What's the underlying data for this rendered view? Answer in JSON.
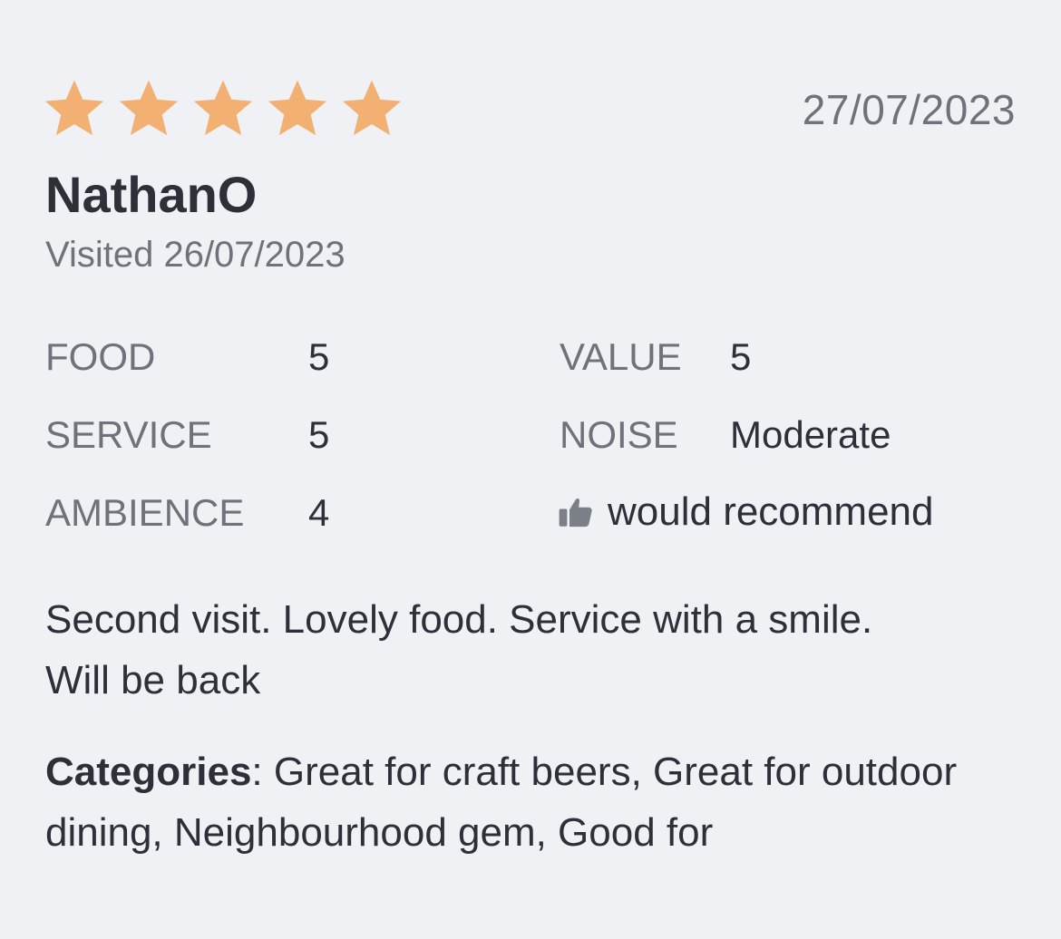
{
  "review": {
    "rating": 5,
    "rating_max": 5,
    "star_color": "#f2b073",
    "date": "27/07/2023",
    "reviewer": "NathanO",
    "visited": "Visited 26/07/2023",
    "ratings": {
      "food_label": "FOOD",
      "food_value": "5",
      "service_label": "SERVICE",
      "service_value": "5",
      "ambience_label": "AMBIENCE",
      "ambience_value": "4",
      "value_label": "VALUE",
      "value_value": "5",
      "noise_label": "NOISE",
      "noise_value": "Moderate"
    },
    "recommend_icon": "thumbs-up-icon",
    "recommend_text": "would recommend",
    "text_line1": "Second visit. Lovely food. Service with a smile.",
    "text_line2": "Will be back",
    "categories_label": "Categories",
    "categories_text": ": Great for craft beers, Great for outdoor dining, Neighbourhood gem, Good for"
  }
}
